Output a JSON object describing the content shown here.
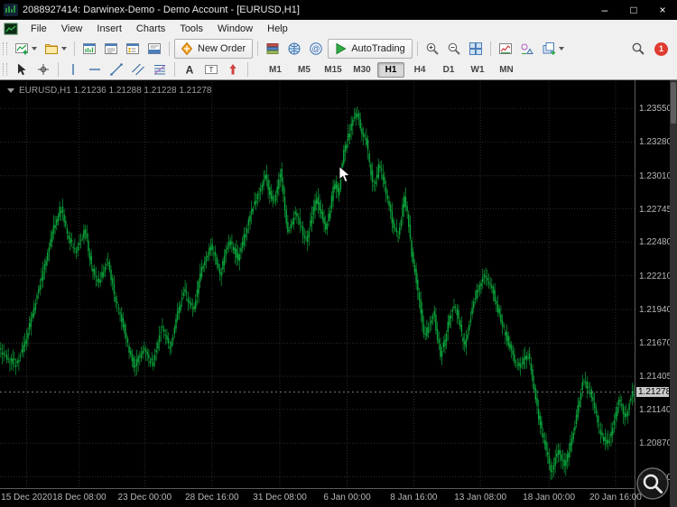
{
  "window": {
    "title": "2088927414: Darwinex-Demo - Demo Account - [EURUSD,H1]",
    "minimize": "–",
    "maximize": "□",
    "close": "×"
  },
  "menu": {
    "items": [
      "File",
      "View",
      "Insert",
      "Charts",
      "Tools",
      "Window",
      "Help"
    ]
  },
  "toolbar_main": {
    "items": [
      {
        "icon": "new-chart",
        "dropdown": true
      },
      {
        "icon": "chart-profiles",
        "dropdown": true
      },
      {
        "sep": true
      },
      {
        "icon": "market-watch"
      },
      {
        "icon": "data-window"
      },
      {
        "icon": "navigator"
      },
      {
        "icon": "terminal"
      },
      {
        "sep": true
      },
      {
        "icon": "new-order",
        "label": "New Order"
      },
      {
        "sep": true
      },
      {
        "icon": "market-books"
      },
      {
        "icon": "signals-globe"
      },
      {
        "icon": "community-at"
      },
      {
        "icon": "autotrading",
        "label": "AutoTrading"
      },
      {
        "sep": true
      },
      {
        "icon": "zoom-in"
      },
      {
        "icon": "zoom-out"
      },
      {
        "icon": "tile-windows"
      },
      {
        "sep": true
      },
      {
        "icon": "indicators"
      },
      {
        "icon": "objects-list"
      },
      {
        "icon": "templates",
        "dropdown": true
      },
      {
        "spacer": true
      },
      {
        "icon": "search"
      },
      {
        "icon": "notifications",
        "badge": "1"
      }
    ]
  },
  "toolbar_draw": {
    "items": [
      {
        "icon": "cursor"
      },
      {
        "icon": "crosshair"
      },
      {
        "sep": true
      },
      {
        "icon": "vertical-line"
      },
      {
        "icon": "horizontal-line"
      },
      {
        "icon": "trendline"
      },
      {
        "icon": "channel"
      },
      {
        "icon": "fibonacci"
      },
      {
        "sep": true
      },
      {
        "icon": "text"
      },
      {
        "icon": "text-label"
      },
      {
        "icon": "arrows"
      },
      {
        "sep": true
      }
    ]
  },
  "timeframes": {
    "items": [
      "M1",
      "M5",
      "M15",
      "M30",
      "H1",
      "H4",
      "D1",
      "W1",
      "MN"
    ],
    "active": "H1"
  },
  "chart": {
    "info": "EURUSD,H1 1.21236 1.21288 1.21228 1.21278",
    "current_price": "1.21278"
  },
  "chart_data": {
    "type": "candlestick",
    "symbol": "EURUSD",
    "timeframe": "H1",
    "ohlc": {
      "open": 1.21236,
      "high": 1.21288,
      "low": 1.21228,
      "close": 1.21278
    },
    "current_price": 1.21278,
    "price_labels": [
      "1.23550",
      "1.23280",
      "1.23010",
      "1.22745",
      "1.22480",
      "1.22210",
      "1.21940",
      "1.21670",
      "1.21405",
      "1.21140",
      "1.20870",
      "1.20600"
    ],
    "time_labels": [
      {
        "t": 0.042,
        "label": "15 Dec 2020"
      },
      {
        "t": 0.125,
        "label": "18 Dec 08:00"
      },
      {
        "t": 0.228,
        "label": "23 Dec 00:00"
      },
      {
        "t": 0.334,
        "label": "28 Dec 16:00"
      },
      {
        "t": 0.441,
        "label": "31 Dec 08:00"
      },
      {
        "t": 0.547,
        "label": "6 Jan 00:00"
      },
      {
        "t": 0.652,
        "label": "8 Jan 16:00"
      },
      {
        "t": 0.757,
        "label": "13 Jan 08:00"
      },
      {
        "t": 0.865,
        "label": "18 Jan 00:00"
      },
      {
        "t": 0.97,
        "label": "20 Jan 16:00"
      }
    ],
    "y_range": {
      "top": 1.2376,
      "bottom": 1.2051
    },
    "candle_count": 420,
    "bull_color": "#0aa23a",
    "grid_color": "#2d2d2d",
    "bid_line_color": "#8c8c8c",
    "axis_text_color": "#b8b8b8",
    "background": "#000000",
    "waypoints": [
      [
        0.0,
        1.2162
      ],
      [
        0.011,
        1.2155
      ],
      [
        0.028,
        1.215
      ],
      [
        0.043,
        1.2172
      ],
      [
        0.057,
        1.22
      ],
      [
        0.071,
        1.2228
      ],
      [
        0.085,
        1.2258
      ],
      [
        0.097,
        1.2276
      ],
      [
        0.108,
        1.2252
      ],
      [
        0.121,
        1.224
      ],
      [
        0.135,
        1.2258
      ],
      [
        0.145,
        1.223
      ],
      [
        0.156,
        1.2215
      ],
      [
        0.171,
        1.2232
      ],
      [
        0.182,
        1.2205
      ],
      [
        0.192,
        1.2188
      ],
      [
        0.203,
        1.2165
      ],
      [
        0.213,
        1.2148
      ],
      [
        0.228,
        1.2162
      ],
      [
        0.242,
        1.215
      ],
      [
        0.256,
        1.218
      ],
      [
        0.27,
        1.2163
      ],
      [
        0.281,
        1.219
      ],
      [
        0.292,
        1.221
      ],
      [
        0.306,
        1.2192
      ],
      [
        0.32,
        1.2228
      ],
      [
        0.334,
        1.2245
      ],
      [
        0.349,
        1.2222
      ],
      [
        0.363,
        1.225
      ],
      [
        0.377,
        1.2235
      ],
      [
        0.39,
        1.2258
      ],
      [
        0.398,
        1.2272
      ],
      [
        0.41,
        1.2288
      ],
      [
        0.42,
        1.23
      ],
      [
        0.428,
        1.2285
      ],
      [
        0.434,
        1.2278
      ],
      [
        0.444,
        1.2305
      ],
      [
        0.455,
        1.2255
      ],
      [
        0.469,
        1.2272
      ],
      [
        0.484,
        1.2248
      ],
      [
        0.494,
        1.2268
      ],
      [
        0.501,
        1.2285
      ],
      [
        0.509,
        1.227
      ],
      [
        0.515,
        1.2258
      ],
      [
        0.522,
        1.2272
      ],
      [
        0.529,
        1.2298
      ],
      [
        0.536,
        1.2285
      ],
      [
        0.543,
        1.2318
      ],
      [
        0.551,
        1.2332
      ],
      [
        0.558,
        1.2345
      ],
      [
        0.565,
        1.2352
      ],
      [
        0.572,
        1.2335
      ],
      [
        0.58,
        1.2328
      ],
      [
        0.586,
        1.2308
      ],
      [
        0.59,
        1.2292
      ],
      [
        0.596,
        1.23
      ],
      [
        0.6,
        1.231
      ],
      [
        0.608,
        1.2295
      ],
      [
        0.615,
        1.2278
      ],
      [
        0.622,
        1.2262
      ],
      [
        0.63,
        1.2252
      ],
      [
        0.64,
        1.2285
      ],
      [
        0.647,
        1.2262
      ],
      [
        0.651,
        1.224
      ],
      [
        0.657,
        1.2222
      ],
      [
        0.661,
        1.2208
      ],
      [
        0.668,
        1.2185
      ],
      [
        0.671,
        1.2172
      ],
      [
        0.679,
        1.2182
      ],
      [
        0.686,
        1.2192
      ],
      [
        0.692,
        1.2172
      ],
      [
        0.697,
        1.2158
      ],
      [
        0.705,
        1.2172
      ],
      [
        0.711,
        1.2188
      ],
      [
        0.718,
        1.2198
      ],
      [
        0.723,
        1.2192
      ],
      [
        0.729,
        1.2178
      ],
      [
        0.734,
        1.2162
      ],
      [
        0.741,
        1.2178
      ],
      [
        0.748,
        1.2198
      ],
      [
        0.757,
        1.2212
      ],
      [
        0.765,
        1.2222
      ],
      [
        0.772,
        1.2215
      ],
      [
        0.78,
        1.2208
      ],
      [
        0.787,
        1.2195
      ],
      [
        0.794,
        1.2182
      ],
      [
        0.801,
        1.2172
      ],
      [
        0.808,
        1.2162
      ],
      [
        0.815,
        1.2152
      ],
      [
        0.822,
        1.2148
      ],
      [
        0.829,
        1.2155
      ],
      [
        0.836,
        1.2158
      ],
      [
        0.842,
        1.2138
      ],
      [
        0.848,
        1.212
      ],
      [
        0.853,
        1.2105
      ],
      [
        0.859,
        1.2092
      ],
      [
        0.865,
        1.2078
      ],
      [
        0.871,
        1.2063
      ],
      [
        0.877,
        1.2072
      ],
      [
        0.882,
        1.2082
      ],
      [
        0.888,
        1.2075
      ],
      [
        0.893,
        1.2068
      ],
      [
        0.9,
        1.2082
      ],
      [
        0.908,
        1.2098
      ],
      [
        0.915,
        1.2118
      ],
      [
        0.922,
        1.2138
      ],
      [
        0.929,
        1.2132
      ],
      [
        0.936,
        1.2125
      ],
      [
        0.943,
        1.2108
      ],
      [
        0.95,
        1.2095
      ],
      [
        0.957,
        1.2088
      ],
      [
        0.964,
        1.209
      ],
      [
        0.971,
        1.2105
      ],
      [
        0.979,
        1.2122
      ],
      [
        0.985,
        1.2112
      ],
      [
        0.99,
        1.2108
      ],
      [
        1.0,
        1.2128
      ]
    ]
  }
}
